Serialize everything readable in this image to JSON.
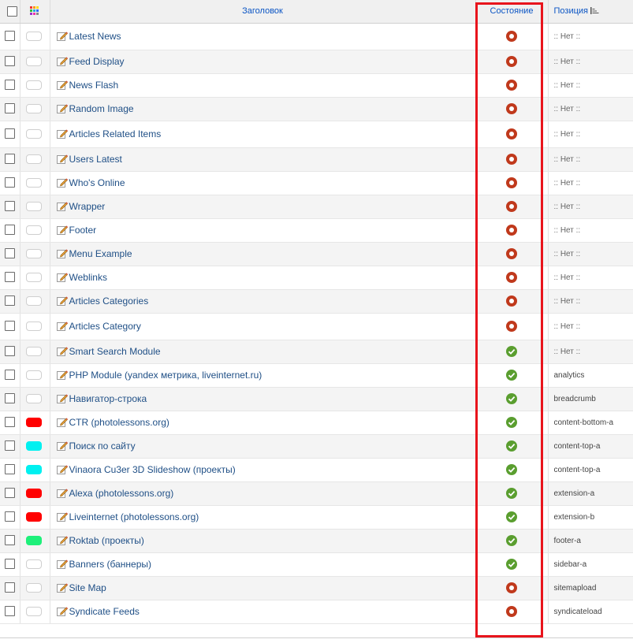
{
  "header": {
    "title_label": "Заголовок",
    "status_label": "Состояние",
    "position_label": "Позиция"
  },
  "colors": {
    "unpublished": "#c0391c",
    "published": "#5a9e2f",
    "highlight": "#e8141c",
    "link": "#1f4f86"
  },
  "rows": [
    {
      "title": "Latest News",
      "status": "unpublished",
      "position": ":: Нет ::",
      "color": "",
      "tall": true
    },
    {
      "title": "Feed Display",
      "status": "unpublished",
      "position": ":: Нет ::",
      "color": ""
    },
    {
      "title": "News Flash",
      "status": "unpublished",
      "position": ":: Нет ::",
      "color": ""
    },
    {
      "title": "Random Image",
      "status": "unpublished",
      "position": ":: Нет ::",
      "color": ""
    },
    {
      "title": "Articles Related Items",
      "status": "unpublished",
      "position": ":: Нет ::",
      "color": "",
      "tall": true
    },
    {
      "title": "Users Latest",
      "status": "unpublished",
      "position": ":: Нет ::",
      "color": ""
    },
    {
      "title": "Who's Online",
      "status": "unpublished",
      "position": ":: Нет ::",
      "color": ""
    },
    {
      "title": "Wrapper",
      "status": "unpublished",
      "position": ":: Нет ::",
      "color": ""
    },
    {
      "title": "Footer",
      "status": "unpublished",
      "position": ":: Нет ::",
      "color": ""
    },
    {
      "title": "Menu Example",
      "status": "unpublished",
      "position": ":: Нет ::",
      "color": ""
    },
    {
      "title": "Weblinks",
      "status": "unpublished",
      "position": ":: Нет ::",
      "color": ""
    },
    {
      "title": "Articles Categories",
      "status": "unpublished",
      "position": ":: Нет ::",
      "color": ""
    },
    {
      "title": "Articles Category",
      "status": "unpublished",
      "position": ":: Нет ::",
      "color": "",
      "tall": true
    },
    {
      "title": "Smart Search Module",
      "status": "published",
      "position": ":: Нет ::",
      "color": ""
    },
    {
      "title": "PHP Module (yandex метрика, liveinternet.ru)",
      "status": "published",
      "position": "analytics",
      "color": ""
    },
    {
      "title": "Навигатор-строка",
      "status": "published",
      "position": "breadcrumb",
      "color": ""
    },
    {
      "title": "CTR (photolessons.org)",
      "status": "published",
      "position": "content-bottom-a",
      "color": "#ff0000"
    },
    {
      "title": "Поиск по сайту",
      "status": "published",
      "position": "content-top-a",
      "color": "#00f0f0"
    },
    {
      "title": "Vinaora Cu3er 3D Slideshow (проекты)",
      "status": "published",
      "position": "content-top-a",
      "color": "#00f0f0"
    },
    {
      "title": "Alexa (photolessons.org)",
      "status": "published",
      "position": "extension-a",
      "color": "#ff0000"
    },
    {
      "title": "Liveinternet (photolessons.org)",
      "status": "published",
      "position": "extension-b",
      "color": "#ff0000"
    },
    {
      "title": "Roktab (проекты)",
      "status": "published",
      "position": "footer-a",
      "color": "#1ef07a"
    },
    {
      "title": "Banners (баннеры)",
      "status": "published",
      "position": "sidebar-a",
      "color": ""
    },
    {
      "title": "Site Map",
      "status": "unpublished",
      "position": "sitemapload",
      "color": ""
    },
    {
      "title": "Syndicate Feeds",
      "status": "unpublished",
      "position": "syndicateload",
      "color": ""
    }
  ]
}
